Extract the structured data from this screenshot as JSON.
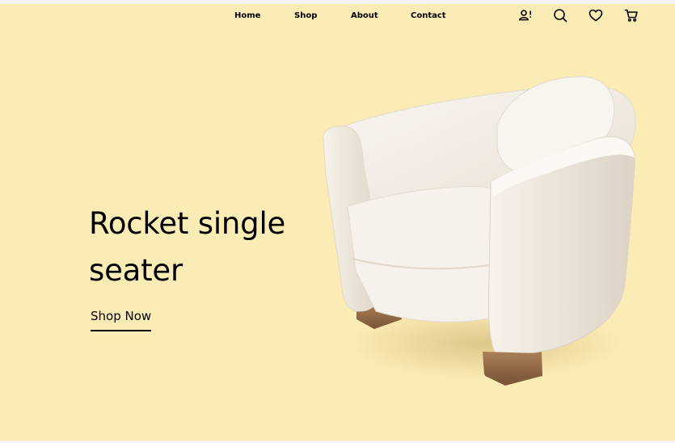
{
  "nav": {
    "links": [
      "Home",
      "Shop",
      "About",
      "Contact"
    ]
  },
  "icons": {
    "account": "user-alert-icon",
    "search": "search-icon",
    "wishlist": "heart-icon",
    "cart": "cart-icon"
  },
  "hero": {
    "title_line1": "Rocket single",
    "title_line2": "seater",
    "cta": "Shop Now"
  },
  "colors": {
    "background": "#fbebb5",
    "text": "#000000"
  }
}
